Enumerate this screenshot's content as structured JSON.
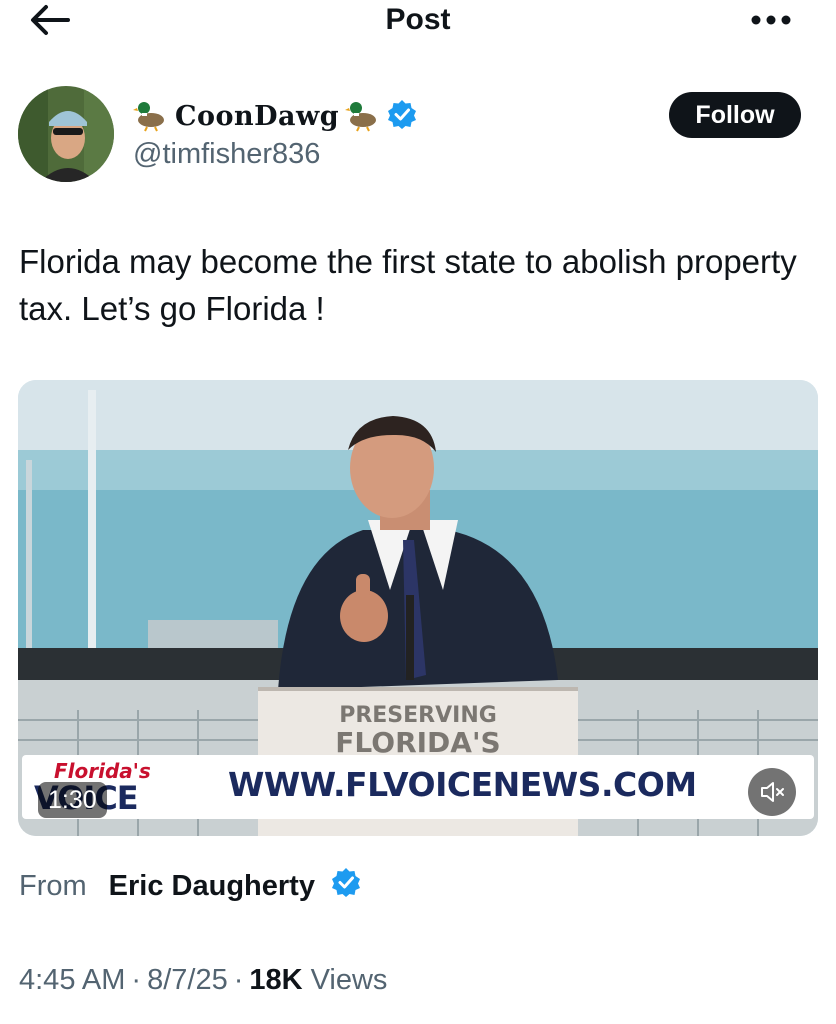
{
  "header": {
    "title": "Post",
    "back_icon": "arrow-left-icon",
    "more_icon": "more-horizontal-icon"
  },
  "author": {
    "display_name": "CoonDawg",
    "handle": "@timfisher836",
    "verified": true,
    "name_decoration_icon": "duck-emoji",
    "follow_label": "Follow"
  },
  "post": {
    "text": "Florida may become  the first state to abolish property tax. Let’s go Florida !"
  },
  "video": {
    "duration": "1:30",
    "podium_line1": "PRESERVING",
    "podium_line2": "FLORIDA'S",
    "banner_logo_top": "Florida's",
    "banner_logo_bottom": "VOICE",
    "banner_url": "WWW.FLVOICENEWS.COM",
    "mute_icon": "volume-muted-icon"
  },
  "attribution": {
    "from_label": "From",
    "name": "Eric Daugherty",
    "verified": true
  },
  "meta": {
    "time": "4:45 AM",
    "separator": "·",
    "date": "8/7/25",
    "views_count": "18K",
    "views_label": "Views"
  },
  "colors": {
    "text_primary": "#0f1419",
    "text_secondary": "#536471",
    "verified_blue": "#1d9bf0",
    "follow_button_bg": "#0f1419"
  }
}
